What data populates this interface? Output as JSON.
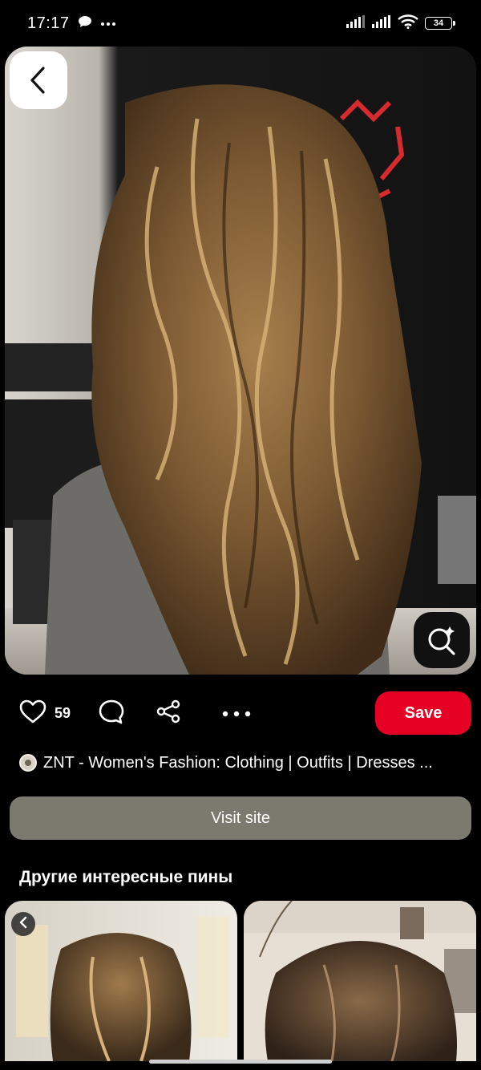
{
  "status_bar": {
    "time": "17:17",
    "battery": "34",
    "icons": [
      "chat-bubble-icon",
      "more-dots-icon",
      "signal-icon",
      "signal-icon",
      "wifi-icon",
      "battery-icon"
    ]
  },
  "pin": {
    "image_alt": "Long wavy brunette hair with caramel balayage highlights",
    "likes": "59",
    "save_label": "Save"
  },
  "source": {
    "title": "ZNT - Women's Fashion: Clothing | Outfits | Dresses ..."
  },
  "visit_site_label": "Visit site",
  "more_pins": {
    "title": "Другие интересные пины"
  },
  "colors": {
    "save": "#e60023",
    "visit_bg": "#7a7a6e",
    "background": "#000000"
  }
}
